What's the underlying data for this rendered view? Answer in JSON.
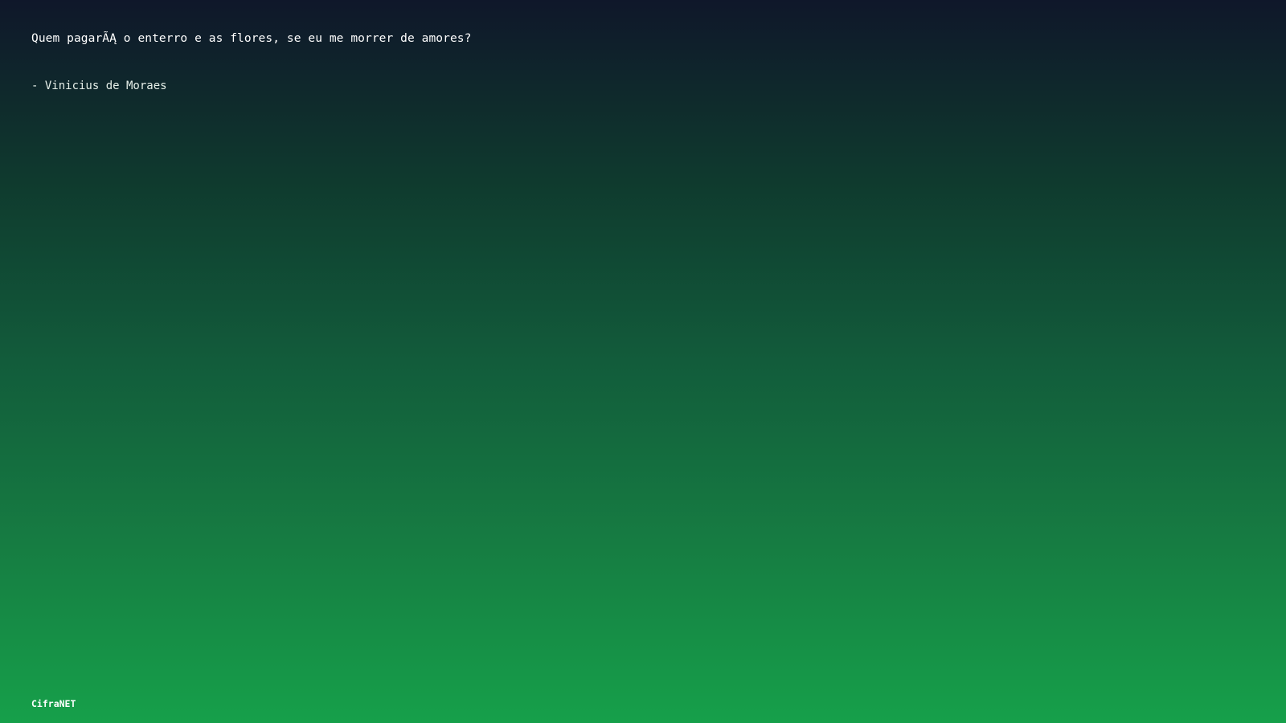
{
  "quote": {
    "text": "Quem pagarÃĄ o enterro e as flores, se eu me morrer de amores?",
    "author": "- Vinicius de Moraes"
  },
  "footer": {
    "brand": "CifraNET"
  },
  "colors": {
    "gradient_top": "#0f172a",
    "gradient_bottom": "#16a04a",
    "text": "#ffffff"
  }
}
